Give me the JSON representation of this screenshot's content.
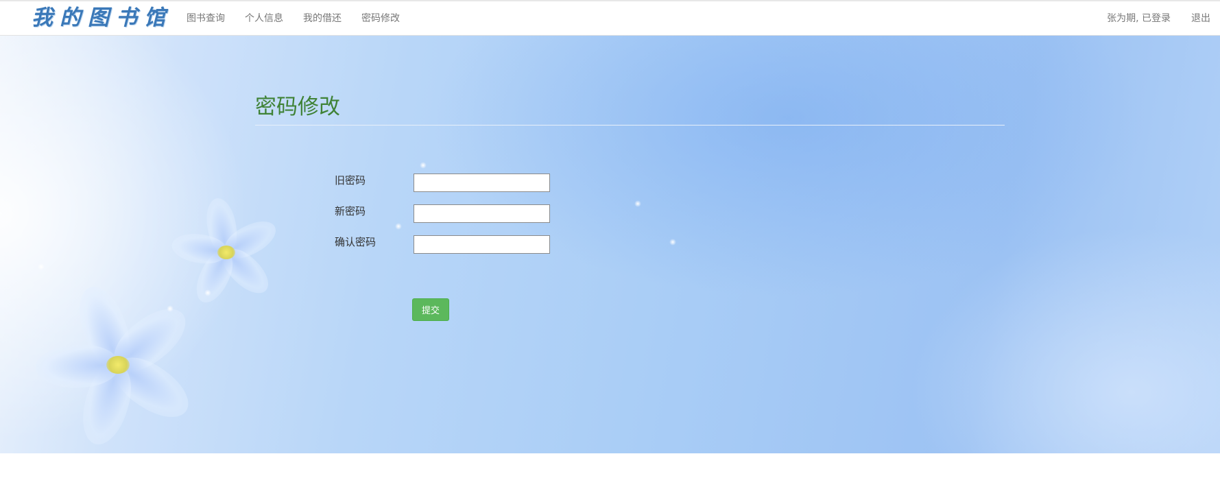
{
  "navbar": {
    "brand": "我的图书馆",
    "links": [
      "图书查询",
      "个人信息",
      "我的借还",
      "密码修改"
    ],
    "user_status": "张为期, 已登录",
    "logout": "退出"
  },
  "page": {
    "title": "密码修改"
  },
  "form": {
    "old_password": {
      "label": "旧密码",
      "value": ""
    },
    "new_password": {
      "label": "新密码",
      "value": ""
    },
    "confirm_password": {
      "label": "确认密码",
      "value": ""
    },
    "submit_label": "提交"
  },
  "colors": {
    "title": "#3f8236",
    "submit": "#5cb85c",
    "brand": "#3a78b8"
  }
}
